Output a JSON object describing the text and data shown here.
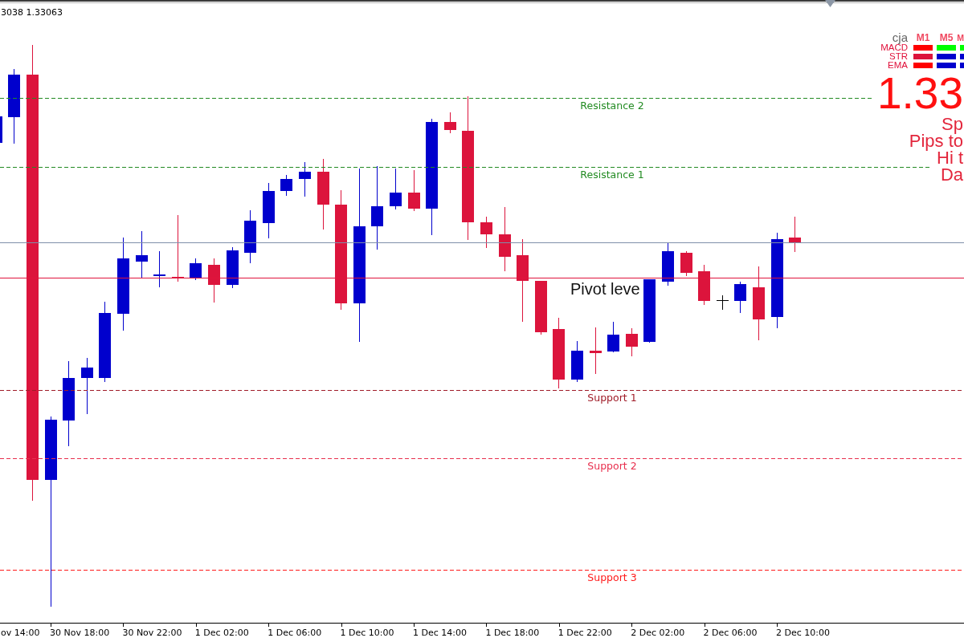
{
  "quote": {
    "text": "3038 1.33063"
  },
  "levels": [
    {
      "label": "Resistance 2",
      "color": "#228b22"
    },
    {
      "label": "Resistance 1",
      "color": "#228b22"
    },
    {
      "label": "Support 1",
      "color": "#a01c28"
    },
    {
      "label": "Support 2",
      "color": "#e8304e"
    },
    {
      "label": "Support 3",
      "color": "#ff1a1a"
    }
  ],
  "pivot": {
    "label": "Pivot leve"
  },
  "dashboard": {
    "title": "cja",
    "timeframes": [
      "M1",
      "M5",
      "M"
    ],
    "rows": [
      {
        "label": "MACD",
        "signals": [
          {
            "color": "#ff0000"
          },
          {
            "color": "#00ff00"
          },
          {
            "color": "#00ff00"
          }
        ]
      },
      {
        "label": "STR",
        "signals": [
          {
            "color": "#dc143c"
          },
          {
            "color": "#0000cd"
          },
          {
            "color": "#0000cd"
          }
        ]
      },
      {
        "label": "EMA",
        "signals": [
          {
            "color": "#ff0000"
          },
          {
            "color": "#0000cd"
          },
          {
            "color": "#0000cd"
          }
        ]
      }
    ],
    "price": "1.33",
    "info_lines": [
      "Sp",
      "Pips to",
      "Hi t",
      "Da"
    ]
  },
  "x_axis": {
    "labels": [
      "ov 14:00",
      "30 Nov 18:00",
      "30 Nov 22:00",
      "1 Dec 02:00",
      "1 Dec 06:00",
      "1 Dec 10:00",
      "1 Dec 14:00",
      "1 Dec 18:00",
      "1 Dec 22:00",
      "2 Dec 02:00",
      "2 Dec 06:00",
      "2 Dec 10:00"
    ]
  }
}
